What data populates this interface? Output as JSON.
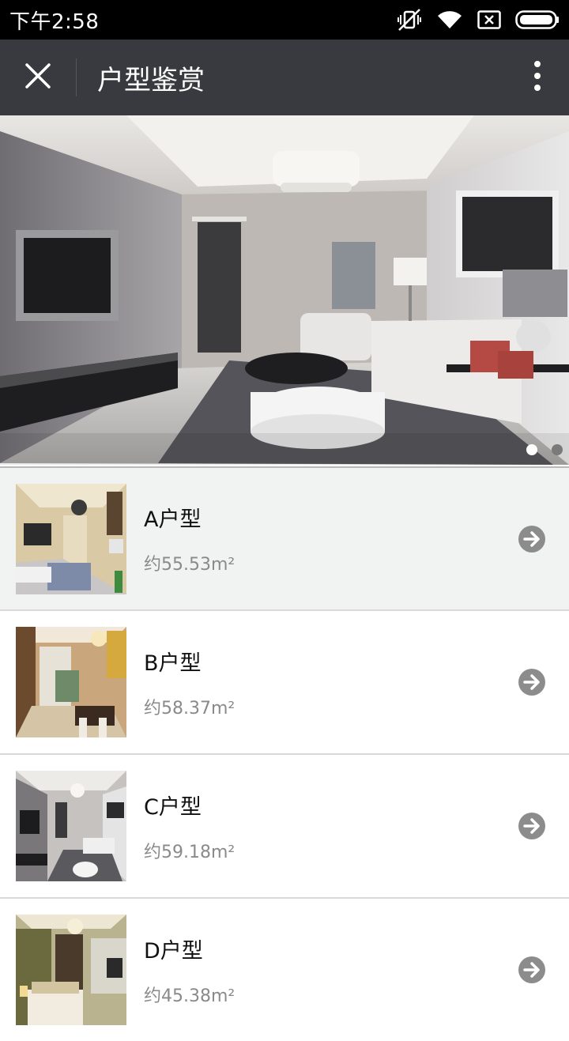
{
  "status_bar": {
    "time": "下午2:58",
    "icons": [
      "mute-vibrate-icon",
      "wifi-icon",
      "sim-off-icon",
      "battery-icon"
    ]
  },
  "title_bar": {
    "close_icon": "close-icon",
    "title": "户型鉴赏",
    "more_icon": "more-vertical-icon"
  },
  "hero": {
    "slide_count": 2,
    "active_slide": 1
  },
  "units": [
    {
      "name": "A户型",
      "area": "约55.53m²"
    },
    {
      "name": "B户型",
      "area": "约58.37m²"
    },
    {
      "name": "C户型",
      "area": "约59.18m²"
    },
    {
      "name": "D户型",
      "area": "约45.38m²"
    }
  ],
  "colors": {
    "titlebar_bg": "#393a3f",
    "status_bg": "#000000",
    "active_row_bg": "#f1f2f2",
    "arrow_icon": "#8c8c8c"
  }
}
